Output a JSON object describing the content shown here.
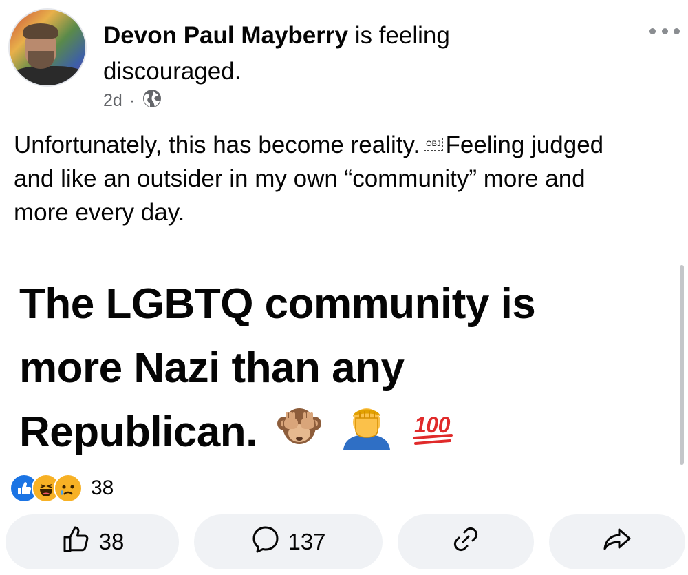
{
  "post": {
    "author": "Devon Paul Mayberry",
    "activity": "is feeling",
    "feeling": "discouraged.",
    "time": "2d",
    "separator": "·",
    "body_before": "Unfortunately, this has become reality.",
    "obj_marker": "OBJ",
    "body_after": "Feeling judged and like an outsider in my own “community” more and more every day."
  },
  "shared_image": {
    "line1": "The LGBTQ community is",
    "line2": "more Nazi than any",
    "line3": "Republican."
  },
  "reactions": {
    "count": "38"
  },
  "actions": {
    "like_count": "38",
    "comment_count": "137"
  },
  "colors": {
    "like_blue": "#1b74e4",
    "haha_yellow": "#f7b125",
    "muted": "#65676b",
    "pill_bg": "#f0f2f5"
  },
  "icons": [
    "globe-icon",
    "more-icon",
    "like-reaction-icon",
    "haha-reaction-icon",
    "sad-reaction-icon",
    "thumbs-up-icon",
    "comment-icon",
    "link-icon",
    "share-icon",
    "see-no-evil-monkey-emoji",
    "face-palm-emoji",
    "hundred-points-emoji"
  ]
}
